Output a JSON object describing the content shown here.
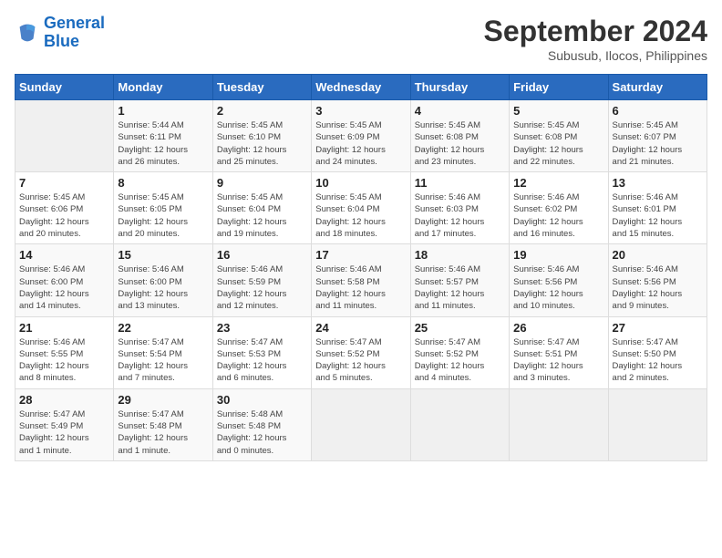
{
  "header": {
    "logo_line1": "General",
    "logo_line2": "Blue",
    "month_title": "September 2024",
    "subtitle": "Subusub, Ilocos, Philippines"
  },
  "weekdays": [
    "Sunday",
    "Monday",
    "Tuesday",
    "Wednesday",
    "Thursday",
    "Friday",
    "Saturday"
  ],
  "days": [
    {
      "num": "",
      "info": ""
    },
    {
      "num": "1",
      "info": "Sunrise: 5:44 AM\nSunset: 6:11 PM\nDaylight: 12 hours\nand 26 minutes."
    },
    {
      "num": "2",
      "info": "Sunrise: 5:45 AM\nSunset: 6:10 PM\nDaylight: 12 hours\nand 25 minutes."
    },
    {
      "num": "3",
      "info": "Sunrise: 5:45 AM\nSunset: 6:09 PM\nDaylight: 12 hours\nand 24 minutes."
    },
    {
      "num": "4",
      "info": "Sunrise: 5:45 AM\nSunset: 6:08 PM\nDaylight: 12 hours\nand 23 minutes."
    },
    {
      "num": "5",
      "info": "Sunrise: 5:45 AM\nSunset: 6:08 PM\nDaylight: 12 hours\nand 22 minutes."
    },
    {
      "num": "6",
      "info": "Sunrise: 5:45 AM\nSunset: 6:07 PM\nDaylight: 12 hours\nand 21 minutes."
    },
    {
      "num": "7",
      "info": "Sunrise: 5:45 AM\nSunset: 6:06 PM\nDaylight: 12 hours\nand 20 minutes."
    },
    {
      "num": "8",
      "info": "Sunrise: 5:45 AM\nSunset: 6:05 PM\nDaylight: 12 hours\nand 20 minutes."
    },
    {
      "num": "9",
      "info": "Sunrise: 5:45 AM\nSunset: 6:04 PM\nDaylight: 12 hours\nand 19 minutes."
    },
    {
      "num": "10",
      "info": "Sunrise: 5:45 AM\nSunset: 6:04 PM\nDaylight: 12 hours\nand 18 minutes."
    },
    {
      "num": "11",
      "info": "Sunrise: 5:46 AM\nSunset: 6:03 PM\nDaylight: 12 hours\nand 17 minutes."
    },
    {
      "num": "12",
      "info": "Sunrise: 5:46 AM\nSunset: 6:02 PM\nDaylight: 12 hours\nand 16 minutes."
    },
    {
      "num": "13",
      "info": "Sunrise: 5:46 AM\nSunset: 6:01 PM\nDaylight: 12 hours\nand 15 minutes."
    },
    {
      "num": "14",
      "info": "Sunrise: 5:46 AM\nSunset: 6:00 PM\nDaylight: 12 hours\nand 14 minutes."
    },
    {
      "num": "15",
      "info": "Sunrise: 5:46 AM\nSunset: 6:00 PM\nDaylight: 12 hours\nand 13 minutes."
    },
    {
      "num": "16",
      "info": "Sunrise: 5:46 AM\nSunset: 5:59 PM\nDaylight: 12 hours\nand 12 minutes."
    },
    {
      "num": "17",
      "info": "Sunrise: 5:46 AM\nSunset: 5:58 PM\nDaylight: 12 hours\nand 11 minutes."
    },
    {
      "num": "18",
      "info": "Sunrise: 5:46 AM\nSunset: 5:57 PM\nDaylight: 12 hours\nand 11 minutes."
    },
    {
      "num": "19",
      "info": "Sunrise: 5:46 AM\nSunset: 5:56 PM\nDaylight: 12 hours\nand 10 minutes."
    },
    {
      "num": "20",
      "info": "Sunrise: 5:46 AM\nSunset: 5:56 PM\nDaylight: 12 hours\nand 9 minutes."
    },
    {
      "num": "21",
      "info": "Sunrise: 5:46 AM\nSunset: 5:55 PM\nDaylight: 12 hours\nand 8 minutes."
    },
    {
      "num": "22",
      "info": "Sunrise: 5:47 AM\nSunset: 5:54 PM\nDaylight: 12 hours\nand 7 minutes."
    },
    {
      "num": "23",
      "info": "Sunrise: 5:47 AM\nSunset: 5:53 PM\nDaylight: 12 hours\nand 6 minutes."
    },
    {
      "num": "24",
      "info": "Sunrise: 5:47 AM\nSunset: 5:52 PM\nDaylight: 12 hours\nand 5 minutes."
    },
    {
      "num": "25",
      "info": "Sunrise: 5:47 AM\nSunset: 5:52 PM\nDaylight: 12 hours\nand 4 minutes."
    },
    {
      "num": "26",
      "info": "Sunrise: 5:47 AM\nSunset: 5:51 PM\nDaylight: 12 hours\nand 3 minutes."
    },
    {
      "num": "27",
      "info": "Sunrise: 5:47 AM\nSunset: 5:50 PM\nDaylight: 12 hours\nand 2 minutes."
    },
    {
      "num": "28",
      "info": "Sunrise: 5:47 AM\nSunset: 5:49 PM\nDaylight: 12 hours\nand 1 minute."
    },
    {
      "num": "29",
      "info": "Sunrise: 5:47 AM\nSunset: 5:48 PM\nDaylight: 12 hours\nand 1 minute."
    },
    {
      "num": "30",
      "info": "Sunrise: 5:48 AM\nSunset: 5:48 PM\nDaylight: 12 hours\nand 0 minutes."
    },
    {
      "num": "",
      "info": ""
    },
    {
      "num": "",
      "info": ""
    },
    {
      "num": "",
      "info": ""
    },
    {
      "num": "",
      "info": ""
    },
    {
      "num": "",
      "info": ""
    }
  ]
}
